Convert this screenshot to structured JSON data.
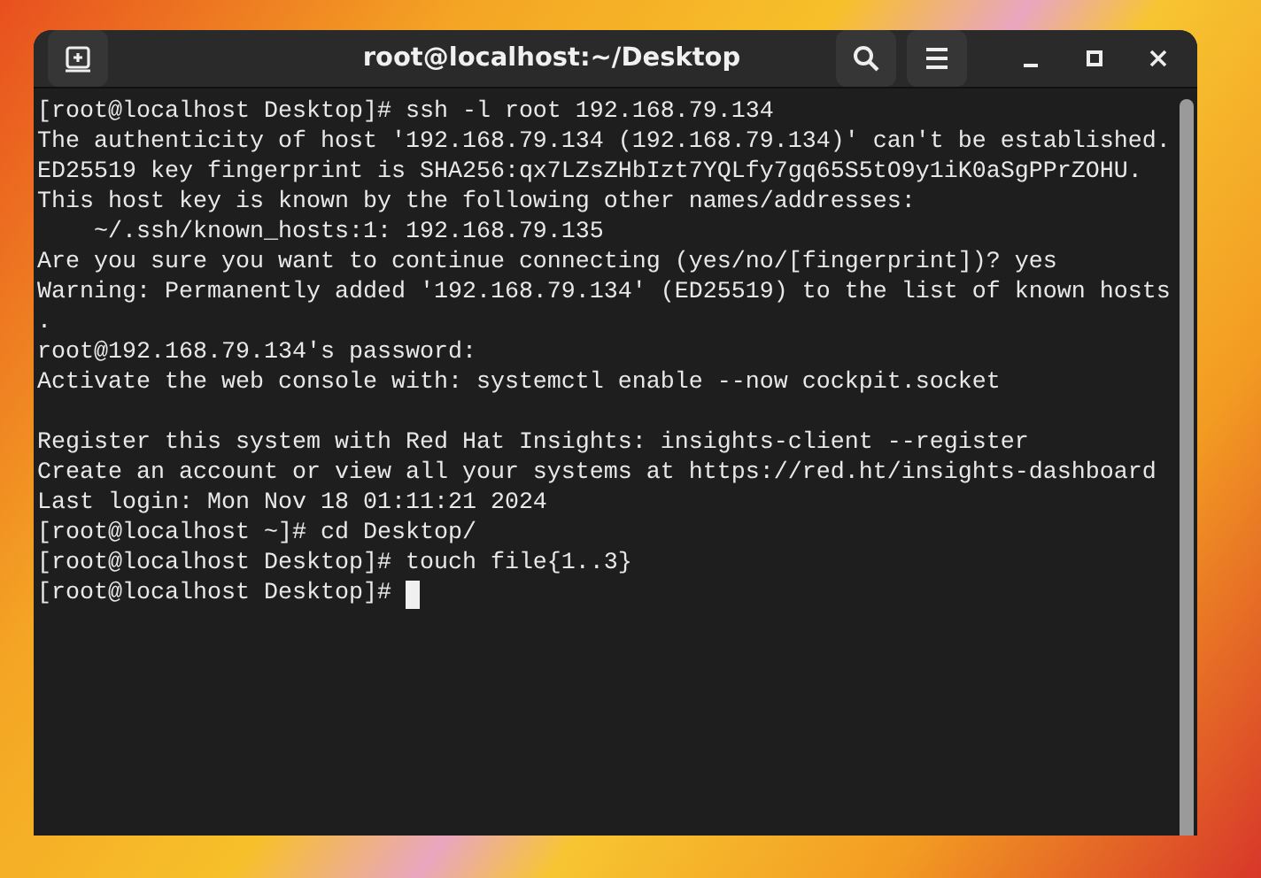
{
  "window": {
    "title": "root@localhost:~/Desktop"
  },
  "terminal": {
    "lines": [
      {
        "kind": "text",
        "text": "[root@localhost Desktop]# ssh -l root 192.168.79.134"
      },
      {
        "kind": "text",
        "text": "The authenticity of host '192.168.79.134 (192.168.79.134)' can't be established."
      },
      {
        "kind": "text",
        "text": "ED25519 key fingerprint is SHA256:qx7LZsZHbIzt7YQLfy7gq65S5tO9y1iK0aSgPPrZOHU."
      },
      {
        "kind": "text",
        "text": "This host key is known by the following other names/addresses:"
      },
      {
        "kind": "text",
        "text": "    ~/.ssh/known_hosts:1: 192.168.79.135"
      },
      {
        "kind": "text",
        "text": "Are you sure you want to continue connecting (yes/no/[fingerprint])? yes"
      },
      {
        "kind": "text",
        "text": "Warning: Permanently added '192.168.79.134' (ED25519) to the list of known hosts"
      },
      {
        "kind": "text",
        "text": "."
      },
      {
        "kind": "text",
        "text": "root@192.168.79.134's password:"
      },
      {
        "kind": "text",
        "text": "Activate the web console with: systemctl enable --now cockpit.socket"
      },
      {
        "kind": "blank"
      },
      {
        "kind": "text",
        "text": "Register this system with Red Hat Insights: insights-client --register"
      },
      {
        "kind": "text",
        "text": "Create an account or view all your systems at https://red.ht/insights-dashboard"
      },
      {
        "kind": "text",
        "text": "Last login: Mon Nov 18 01:11:21 2024"
      },
      {
        "kind": "text",
        "text": "[root@localhost ~]# cd Desktop/"
      },
      {
        "kind": "text",
        "text": "[root@localhost Desktop]# touch file{1..3}"
      },
      {
        "kind": "prompt",
        "text": "[root@localhost Desktop]#"
      }
    ]
  }
}
